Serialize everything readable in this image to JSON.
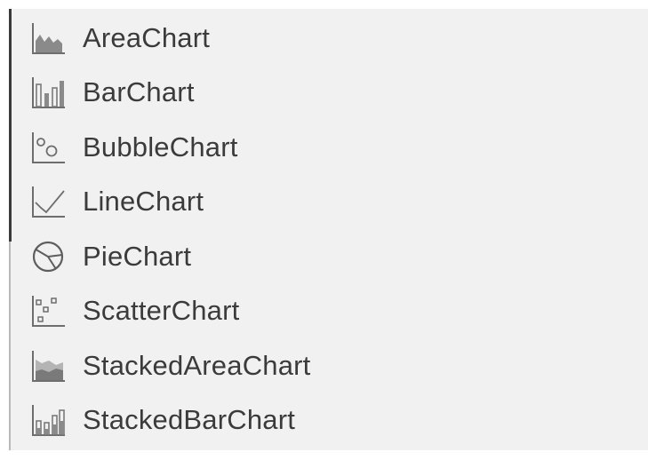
{
  "palette": {
    "panel_background": "#f1f1f1",
    "label_text": "#3b3b3b",
    "icon_stroke": "#6e6e6e",
    "icon_fill": "#8a8a8a"
  },
  "chart_types": [
    {
      "label": "AreaChart",
      "icon": "area-chart-icon"
    },
    {
      "label": "BarChart",
      "icon": "bar-chart-icon"
    },
    {
      "label": "BubbleChart",
      "icon": "bubble-chart-icon"
    },
    {
      "label": "LineChart",
      "icon": "line-chart-icon"
    },
    {
      "label": "PieChart",
      "icon": "pie-chart-icon"
    },
    {
      "label": "ScatterChart",
      "icon": "scatter-chart-icon"
    },
    {
      "label": "StackedAreaChart",
      "icon": "stacked-area-chart-icon"
    },
    {
      "label": "StackedBarChart",
      "icon": "stacked-bar-chart-icon"
    }
  ]
}
